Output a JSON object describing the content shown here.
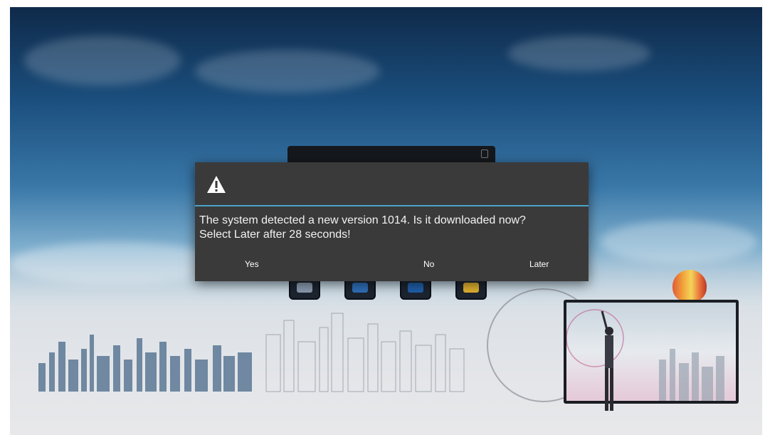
{
  "dialog": {
    "icon": "warning-icon",
    "message_line1": "The system detected a new version 1014. Is it downloaded now?",
    "message_line2": "Select Later after 28 seconds!",
    "buttons": {
      "yes": "Yes",
      "no": "No",
      "later": "Later"
    },
    "accent_color": "#4aa3c9",
    "background_color": "#3a3a3a"
  },
  "background": {
    "apps": [
      "app-tile-1",
      "app-tile-2",
      "app-tile-3",
      "app-tile-4"
    ]
  }
}
